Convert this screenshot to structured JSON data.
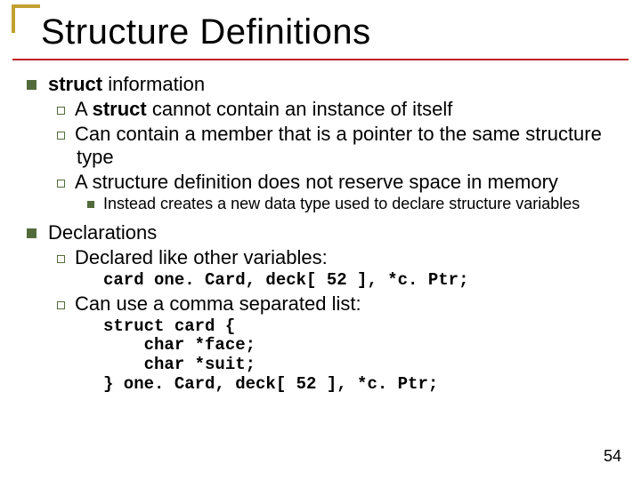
{
  "title": "Structure Definitions",
  "line1_prefix": "struct",
  "line1_rest": " information",
  "sub1_a": "A ",
  "sub1_b": "struct",
  "sub1_c": " cannot contain an instance of itself",
  "sub2": "Can contain a member that is a pointer to the same structure type",
  "sub3": "A structure definition does not reserve space in memory",
  "sub3a": "Instead creates a new data type used to declare structure variables",
  "line2": "Declarations",
  "sub4": "Declared like other variables:",
  "code1": "card one. Card, deck[ 52 ], *c. Ptr;",
  "sub5": "Can use a comma separated list:",
  "code2": "struct card {\n    char *face;\n    char *suit;\n} one. Card, deck[ 52 ], *c. Ptr;",
  "page": "54"
}
